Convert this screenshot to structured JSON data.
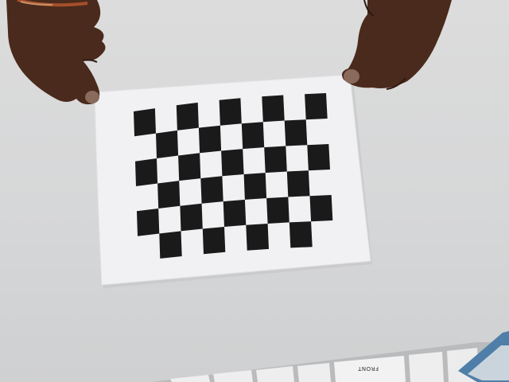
{
  "scene": {
    "background_color": "#d8d8d8",
    "paper_color": "#f1f1f4",
    "square_color": "#1a1a1a",
    "skin_color": "#4a2a1c",
    "checkerboard": {
      "columns": 9,
      "rows": 6
    },
    "keyboard": {
      "key_label": "FRONT"
    }
  }
}
